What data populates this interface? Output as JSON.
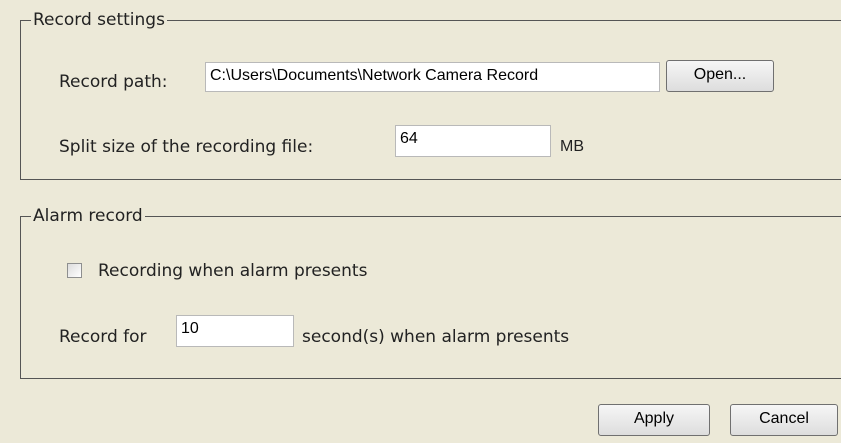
{
  "record_settings": {
    "title": "Record settings",
    "path_label": "Record path:",
    "path_value": "C:\\Users\\Documents\\Network Camera Record",
    "open_button": "Open...",
    "split_label": "Split size of the recording file:",
    "split_value": "64",
    "split_unit": "MB"
  },
  "alarm_record": {
    "title": "Alarm record",
    "checkbox_label": "Recording when alarm presents",
    "checkbox_checked": false,
    "record_for_label": "Record for",
    "record_for_value": "10",
    "record_for_suffix": "second(s) when alarm presents"
  },
  "footer": {
    "apply_button": "Apply",
    "cancel_button": "Cancel"
  }
}
